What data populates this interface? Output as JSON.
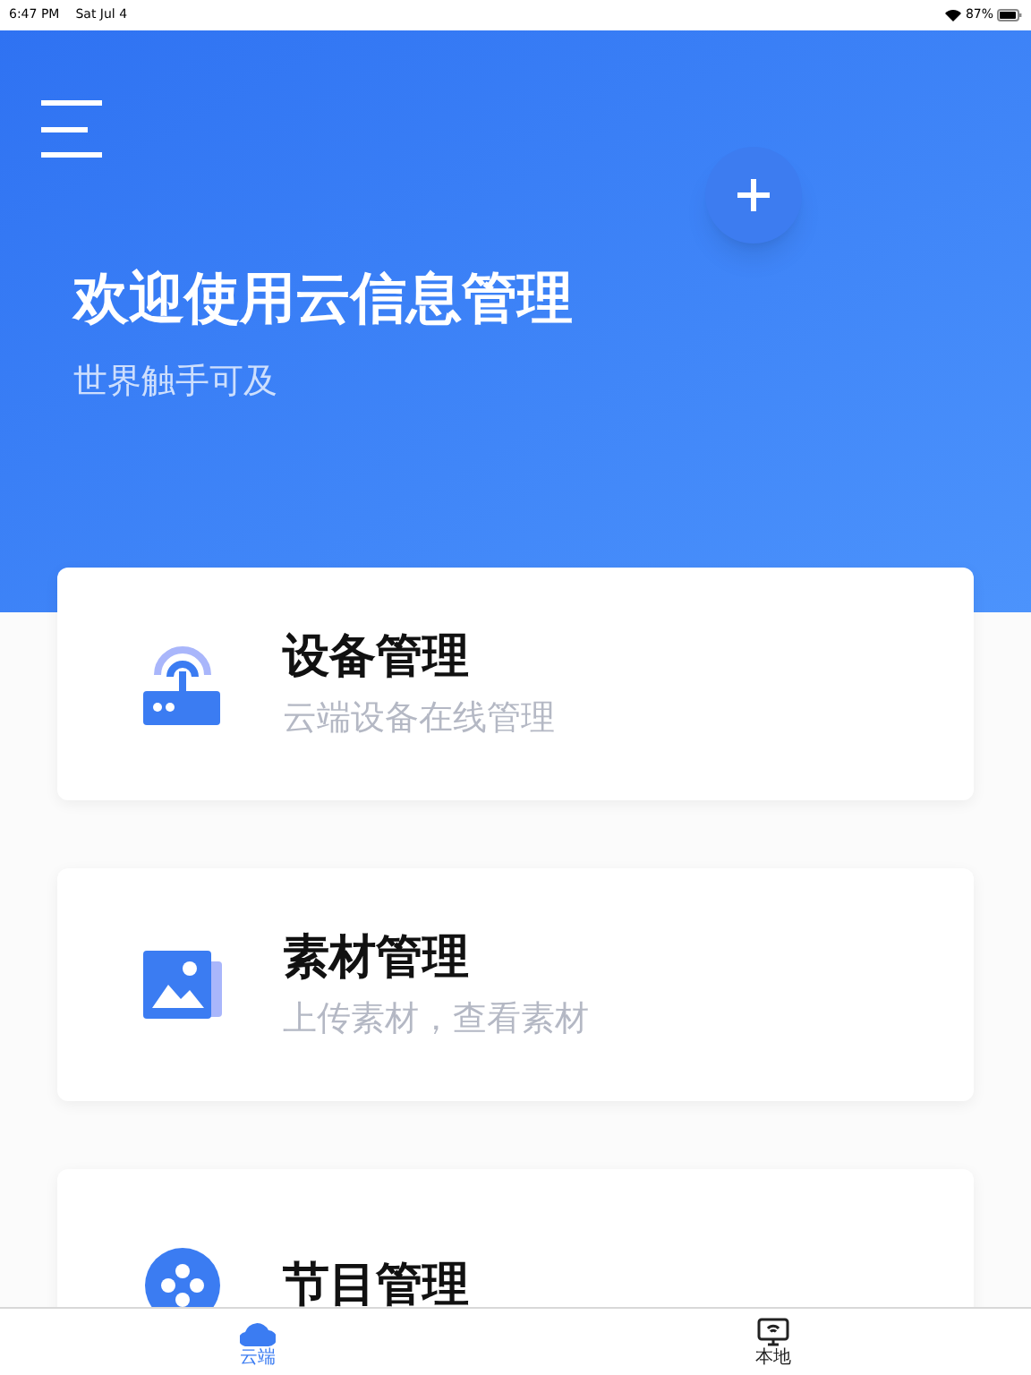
{
  "status_bar": {
    "time": "6:47 PM",
    "date": "Sat Jul 4",
    "battery": "87%"
  },
  "header": {
    "title": "欢迎使用云信息管理",
    "subtitle": "世界触手可及"
  },
  "cards": [
    {
      "kind": "device",
      "title": "设备管理",
      "subtitle": "云端设备在线管理"
    },
    {
      "kind": "media",
      "title": "素材管理",
      "subtitle": "上传素材，查看素材"
    },
    {
      "kind": "program",
      "title": "节目管理"
    }
  ],
  "tabs": [
    {
      "kind": "cloud",
      "label": "云端",
      "selected": true
    },
    {
      "kind": "local",
      "label": "本地",
      "selected": false
    }
  ]
}
